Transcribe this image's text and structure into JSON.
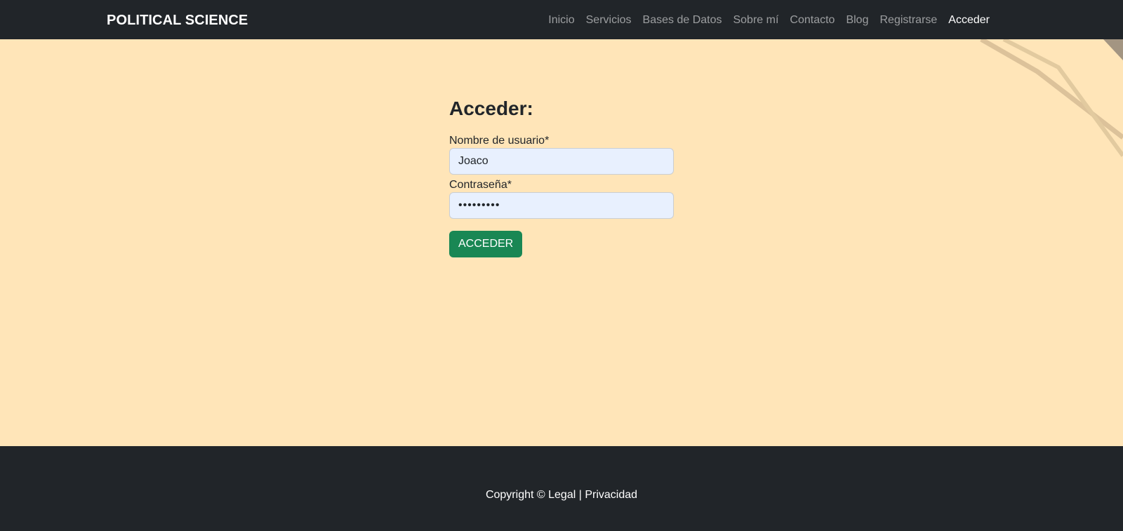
{
  "navbar": {
    "brand": "POLITICAL SCIENCE",
    "links": [
      {
        "label": "Inicio"
      },
      {
        "label": "Servicios"
      },
      {
        "label": "Bases de Datos"
      },
      {
        "label": "Sobre mí"
      },
      {
        "label": "Contacto"
      },
      {
        "label": "Blog"
      },
      {
        "label": "Registrarse"
      },
      {
        "label": "Acceder",
        "active": true
      }
    ]
  },
  "login_form": {
    "title": "Acceder:",
    "username_label": "Nombre de usuario*",
    "username_value": "Joaco",
    "password_label": "Contraseña*",
    "password_value": "•••••••••",
    "submit_label": "ACCEDER"
  },
  "footer": {
    "copyright": "Copyright ©",
    "legal_link": "Legal",
    "separator": "|",
    "privacy_link": "Privacidad"
  },
  "colors": {
    "navbar_bg": "#212529",
    "main_bg": "#ffe5b8",
    "input_bg": "#e8f0fe",
    "button_bg": "#198754",
    "footer_bg": "#212529"
  }
}
